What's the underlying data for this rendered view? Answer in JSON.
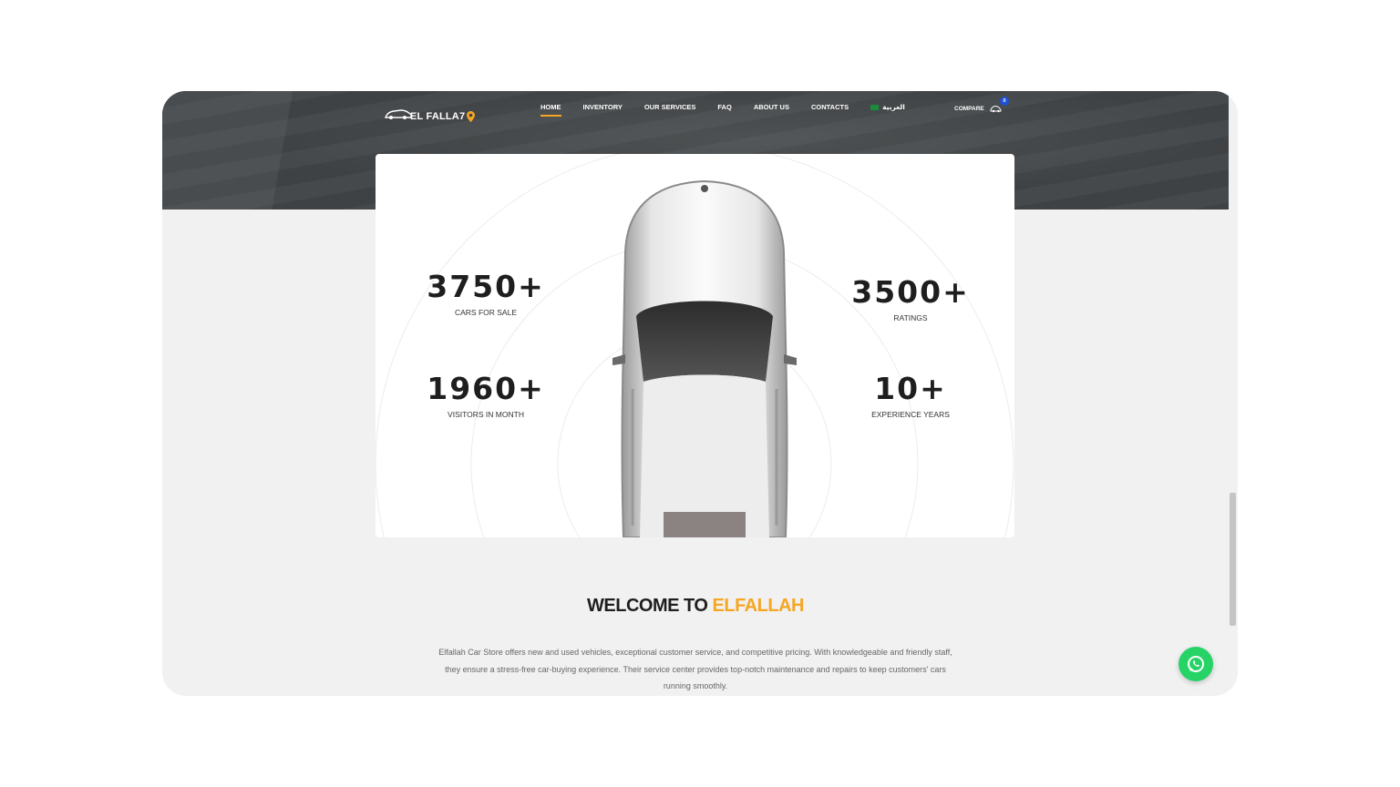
{
  "brand": {
    "logo_text": "EL FALLA7"
  },
  "nav": {
    "items": [
      {
        "label": "HOME",
        "active": true
      },
      {
        "label": "INVENTORY"
      },
      {
        "label": "OUR SERVICES"
      },
      {
        "label": "FAQ"
      },
      {
        "label": "ABOUT US"
      },
      {
        "label": "CONTACTS"
      }
    ],
    "language_label": "العربية",
    "compare_label": "COMPARE",
    "compare_count": "0"
  },
  "stats": [
    {
      "value": "3750+",
      "label": "CARS FOR SALE"
    },
    {
      "value": "1960+",
      "label": "VISITORS IN MONTH"
    },
    {
      "value": "3500+",
      "label": "RATINGS"
    },
    {
      "value": "10+",
      "label": "EXPERIENCE YEARS"
    }
  ],
  "welcome": {
    "title_prefix": "WELCOME TO ",
    "title_accent": "ELFALLAH",
    "body": "Elfallah Car Store offers new and used vehicles, exceptional customer service, and competitive pricing. With knowledgeable and friendly staff, they ensure a stress-free car-buying experience. Their service center provides top-notch maintenance and repairs to keep customers' cars running smoothly."
  },
  "colors": {
    "accent": "#f5a623",
    "dark_band": "#3e4143",
    "whatsapp": "#25d366",
    "badge": "#1d4fd8"
  }
}
